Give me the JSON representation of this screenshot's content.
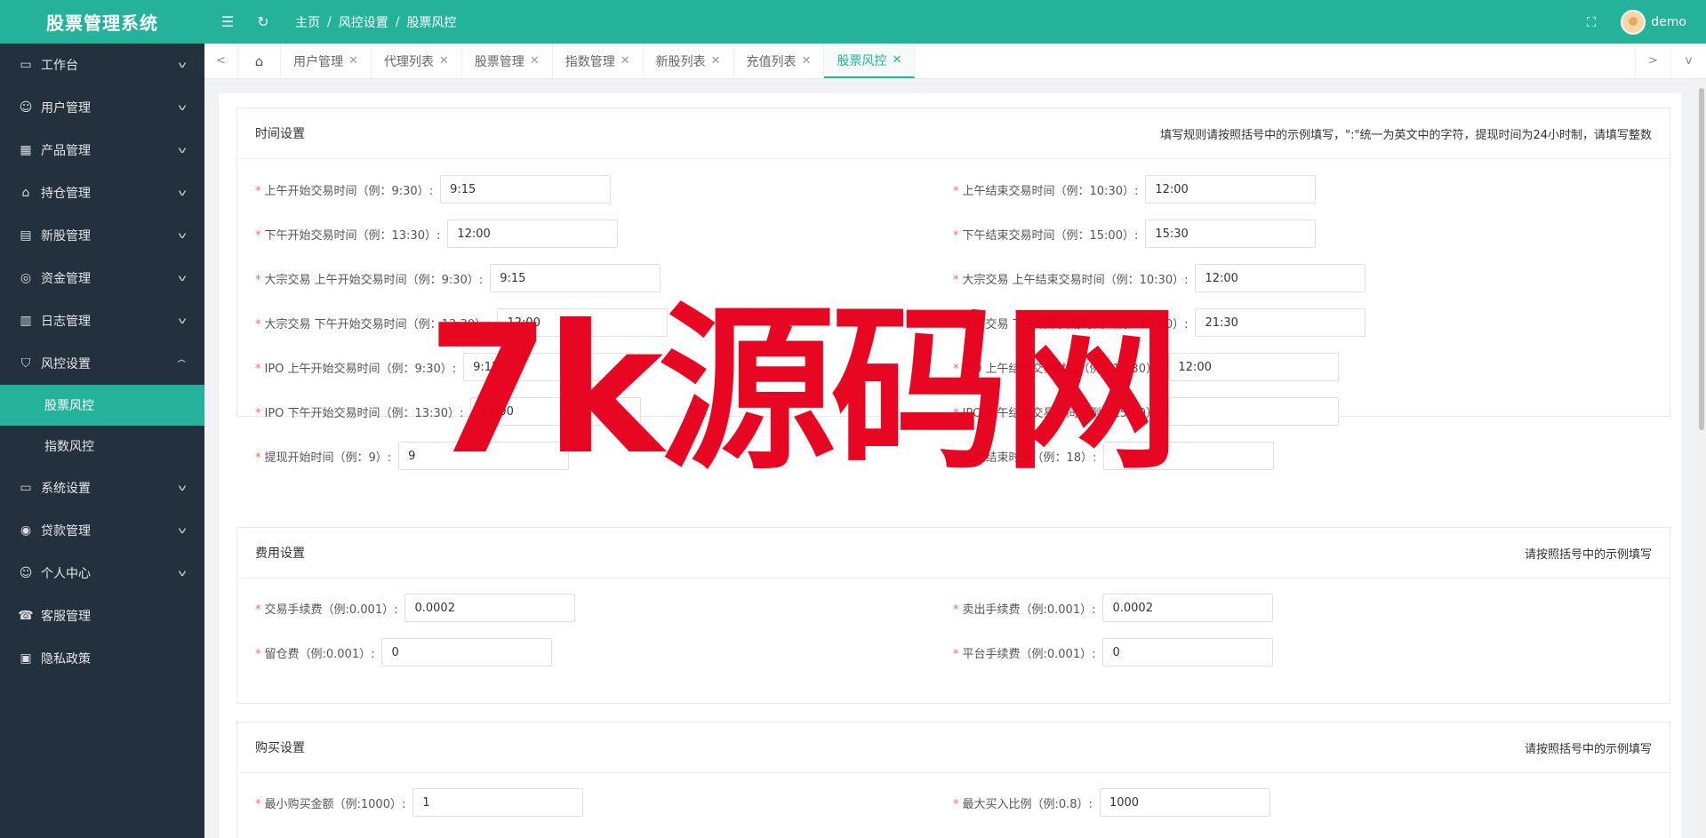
{
  "brand": "股票管理系统",
  "header": {
    "breadcrumb": [
      "主页",
      "风控设置",
      "股票风控"
    ],
    "user_name": "demo"
  },
  "sidebar": {
    "items": [
      {
        "label": "工作台",
        "icon": "monitor-icon"
      },
      {
        "label": "用户管理",
        "icon": "user-icon"
      },
      {
        "label": "产品管理",
        "icon": "grid-icon"
      },
      {
        "label": "持仓管理",
        "icon": "home-icon"
      },
      {
        "label": "新股管理",
        "icon": "chart-icon"
      },
      {
        "label": "资金管理",
        "icon": "coins-icon"
      },
      {
        "label": "日志管理",
        "icon": "log-icon"
      },
      {
        "label": "风控设置",
        "icon": "shield-icon"
      }
    ],
    "sub_items": [
      "股票风控",
      "指数风控"
    ],
    "items_after": [
      {
        "label": "系统设置",
        "icon": "settings-icon"
      },
      {
        "label": "贷款管理",
        "icon": "loan-icon"
      },
      {
        "label": "个人中心",
        "icon": "person-icon"
      },
      {
        "label": "客服管理",
        "icon": "service-icon"
      },
      {
        "label": "隐私政策",
        "icon": "privacy-icon"
      }
    ]
  },
  "tabs": [
    "用户管理",
    "代理列表",
    "股票管理",
    "指数管理",
    "新股列表",
    "充值列表",
    "股票风控"
  ],
  "time_section": {
    "title": "时间设置",
    "note": "填写规则请按照括号中的示例填写，\":\"统一为英文中的字符，提现时间为24小时制，请填写整数",
    "left": [
      {
        "label": "上午开始交易时间（例：9:30）:",
        "value": "9:15"
      },
      {
        "label": "下午开始交易时间（例：13:30）:",
        "value": "12:00"
      },
      {
        "label": "大宗交易 上午开始交易时间（例：9:30）:",
        "value": "9:15"
      },
      {
        "label": "大宗交易 下午开始交易时间（例：13:30）:",
        "value": "12:00"
      },
      {
        "label": "IPO 上午开始交易时间（例：9:30）:",
        "value": "9:15"
      },
      {
        "label": "IPO 下午开始交易时间（例：13:30）:",
        "value": "12:00"
      },
      {
        "label": "提现开始时间（例：9）:",
        "value": "9"
      }
    ],
    "right": [
      {
        "label": "上午结束交易时间（例：10:30）:",
        "value": "12:00"
      },
      {
        "label": "下午结束交易时间（例：15:00）:",
        "value": "15:30"
      },
      {
        "label": "大宗交易 上午结束交易时间（例：10:30）:",
        "value": "12:00"
      },
      {
        "label": "大宗交易 下午结束交易时间（例：15:00）:",
        "value": "21:30"
      },
      {
        "label": "IPO 上午结束交易时间（例：10:30）:",
        "value": "12:00"
      },
      {
        "label": "IPO 下午结束交易时间（例：15:00）:",
        "value": ""
      },
      {
        "label": "提现结束时间（例：18）:",
        "value": ""
      }
    ]
  },
  "fee_section": {
    "title": "费用设置",
    "note": "请按照括号中的示例填写",
    "left": [
      {
        "label": "交易手续费（例:0.001）:",
        "value": "0.0002"
      },
      {
        "label": "留仓费（例:0.001）:",
        "value": "0"
      }
    ],
    "right": [
      {
        "label": "卖出手续费（例:0.001）:",
        "value": "0.0002"
      },
      {
        "label": "平台手续费（例:0.001）:",
        "value": "0"
      }
    ]
  },
  "buy_section": {
    "title": "购买设置",
    "note": "请按照括号中的示例填写",
    "left": [
      {
        "label": "最小购买金额（例:1000）:",
        "value": "1"
      }
    ],
    "right": [
      {
        "label": "最大买入比例（例:0.8）:",
        "value": "1000"
      }
    ]
  },
  "watermark": "7k源码网",
  "colors": {
    "accent": "#25b29a",
    "sidebar_bg": "#23303d",
    "required": "#f56c6c",
    "watermark": "#e8001c"
  }
}
